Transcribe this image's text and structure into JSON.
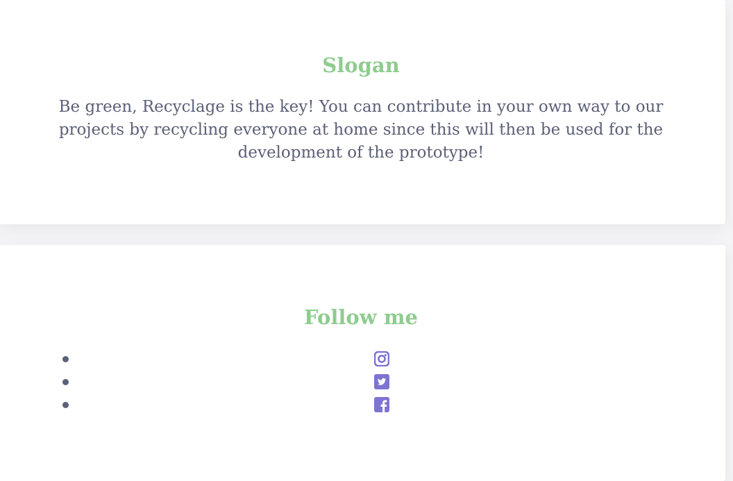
{
  "theme": {
    "accent": "#8fcc8f",
    "text": "#5c6077",
    "icon": "#7d73d1",
    "background": "#ffffff"
  },
  "slogan_section": {
    "title": "Slogan",
    "body": "Be green, Recyclage is the key! You can contribute in your own way to our projects by recycling everyone at home since this will then be used for the development of the prototype!"
  },
  "follow_section": {
    "title": "Follow me",
    "social_links": [
      {
        "icon": "instagram-icon"
      },
      {
        "icon": "twitter-icon"
      },
      {
        "icon": "facebook-icon"
      }
    ]
  }
}
